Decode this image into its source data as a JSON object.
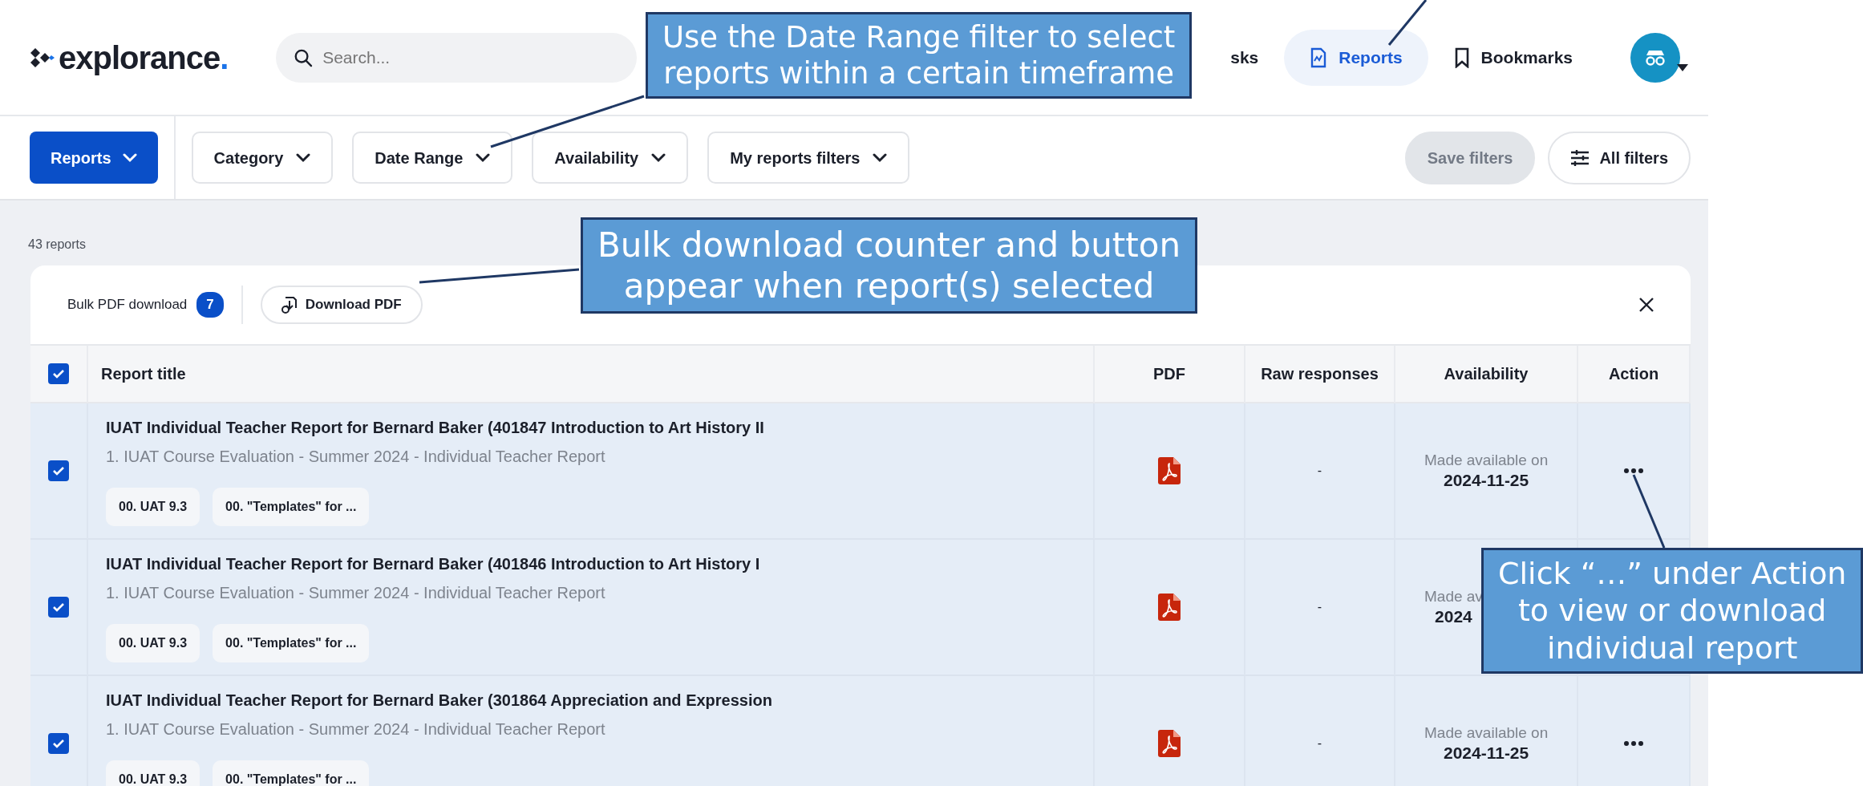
{
  "header": {
    "logo": "explorance.",
    "search": {
      "placeholder": "Search..."
    },
    "nav": [
      {
        "label": "sks",
        "kind": "text",
        "selected": false
      },
      {
        "label": "Reports",
        "kind": "reports",
        "selected": true
      },
      {
        "label": "Bookmarks",
        "kind": "bookmark",
        "selected": false
      }
    ]
  },
  "filter_bar": {
    "menu": "Reports",
    "filters": [
      "Category",
      "Date Range",
      "Availability",
      "My reports filters"
    ],
    "save": {
      "label": "Save filters",
      "disabled": true
    },
    "all_filters": "All filters"
  },
  "count": "43 reports",
  "bulk": {
    "label": "Bulk PDF download",
    "count": "7",
    "button": "Download PDF"
  },
  "table": {
    "select_all_checked": true,
    "columns": [
      "Report title",
      "PDF",
      "Raw responses",
      "Availability",
      "Action"
    ],
    "rows": [
      {
        "checked": true,
        "title": "IUAT Individual Teacher Report for Bernard Baker  (401847 Introduction to Art History II",
        "subtitle": "1. IUAT Course Evaluation - Summer 2024 - Individual Teacher Report",
        "tags": [
          "00. UAT 9.3",
          "00. \"Templates\" for ..."
        ],
        "raw": "-",
        "availability_label": "Made available on",
        "availability_date": "2024-11-25"
      },
      {
        "checked": true,
        "title": "IUAT Individual Teacher Report for Bernard Baker  (401846 Introduction to Art History I",
        "subtitle": "1. IUAT Course Evaluation - Summer 2024 - Individual Teacher Report",
        "tags": [
          "00. UAT 9.3",
          "00. \"Templates\" for ..."
        ],
        "raw": "-",
        "availability_label": "Made av",
        "availability_date": "2024"
      },
      {
        "checked": true,
        "title": "IUAT Individual Teacher Report for Bernard Baker  (301864 Appreciation and Expression",
        "subtitle": "1. IUAT Course Evaluation - Summer 2024 - Individual Teacher Report",
        "tags": [
          "00. UAT 9.3",
          "00. \"Templates\" for ..."
        ],
        "raw": "-",
        "availability_label": "Made available on",
        "availability_date": "2024-11-25"
      }
    ]
  },
  "callouts": [
    {
      "lines": [
        "Use the Date Range filter to select",
        "reports within a certain timeframe"
      ]
    },
    {
      "lines": [
        "Bulk download counter and button",
        "appear when report(s) selected"
      ]
    },
    {
      "lines": [
        "Click “…” under Action",
        "to view or download",
        "individual report"
      ]
    }
  ]
}
